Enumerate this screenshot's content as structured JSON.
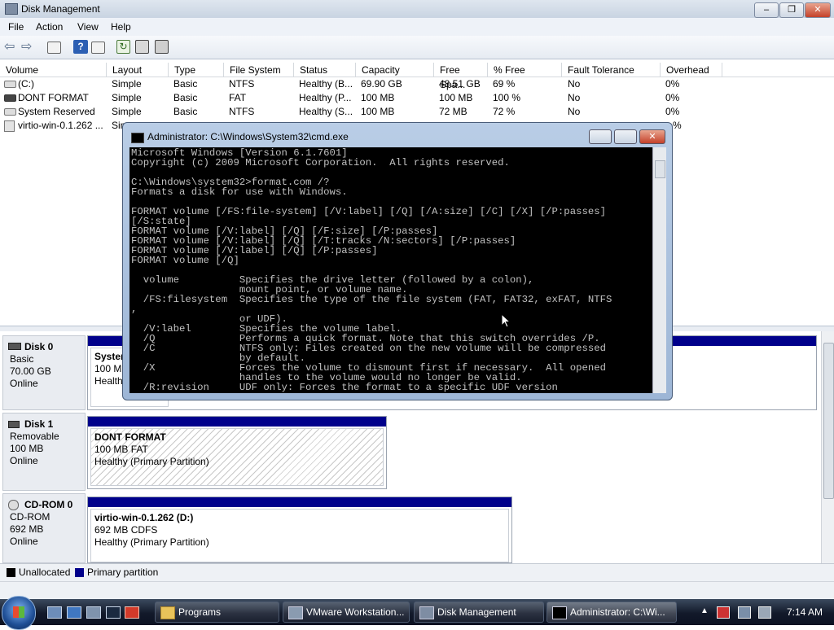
{
  "window": {
    "title": "Disk Management",
    "min": "–",
    "max": "❐",
    "close": "✕"
  },
  "menu": [
    "File",
    "Action",
    "View",
    "Help"
  ],
  "toolbar_icons": [
    "back-icon",
    "forward-icon",
    "properties-icon",
    "help-icon",
    "console-icon",
    "refresh-icon",
    "settings-icon",
    "wizard-icon"
  ],
  "volumes": {
    "columns": [
      "Volume",
      "Layout",
      "Type",
      "File System",
      "Status",
      "Capacity",
      "Free Spa...",
      "% Free",
      "Fault Tolerance",
      "Overhead"
    ],
    "rows": [
      [
        "(C:)",
        "Simple",
        "Basic",
        "NTFS",
        "Healthy (B...",
        "69.90 GB",
        "48.51 GB",
        "69 %",
        "No",
        "0%"
      ],
      [
        "DONT FORMAT",
        "Simple",
        "Basic",
        "FAT",
        "Healthy (P...",
        "100 MB",
        "100 MB",
        "100 %",
        "No",
        "0%"
      ],
      [
        "System Reserved",
        "Simple",
        "Basic",
        "NTFS",
        "Healthy (S...",
        "100 MB",
        "72 MB",
        "72 %",
        "No",
        "0%"
      ],
      [
        "virtio-win-0.1.262 ...",
        "Sim",
        "",
        "",
        "",
        "",
        "",
        "",
        "",
        "%"
      ]
    ]
  },
  "disks": [
    {
      "name": "Disk 0",
      "type": "Basic",
      "size": "70.00 GB",
      "status": "Online",
      "partition": {
        "name": "System",
        "line2": "100 MB",
        "line3": "Healthy"
      }
    },
    {
      "name": "Disk 1",
      "type": "Removable",
      "size": "100 MB",
      "status": "Online",
      "partition": {
        "name": "DONT FORMAT",
        "line2": "100 MB FAT",
        "line3": "Healthy (Primary Partition)"
      }
    },
    {
      "name": "CD-ROM 0",
      "type": "CD-ROM",
      "size": "692 MB",
      "status": "Online",
      "partition": {
        "name": "virtio-win-0.1.262  (D:)",
        "line2": "692 MB CDFS",
        "line3": "Healthy (Primary Partition)"
      }
    }
  ],
  "legend": {
    "unallocated": "Unallocated",
    "primary": "Primary partition",
    "unallocated_color": "#000000",
    "primary_color": "#00008b"
  },
  "cmd": {
    "title": "Administrator: C:\\Windows\\System32\\cmd.exe",
    "text": "Microsoft Windows [Version 6.1.7601]\nCopyright (c) 2009 Microsoft Corporation.  All rights reserved.\n\nC:\\Windows\\system32>format.com /?\nFormats a disk for use with Windows.\n\nFORMAT volume [/FS:file-system] [/V:label] [/Q] [/A:size] [/C] [/X] [/P:passes]\n[/S:state]\nFORMAT volume [/V:label] [/Q] [/F:size] [/P:passes]\nFORMAT volume [/V:label] [/Q] [/T:tracks /N:sectors] [/P:passes]\nFORMAT volume [/V:label] [/Q] [/P:passes]\nFORMAT volume [/Q]\n\n  volume          Specifies the drive letter (followed by a colon),\n                  mount point, or volume name.\n  /FS:filesystem  Specifies the type of the file system (FAT, FAT32, exFAT, NTFS\n,\n                  or UDF).\n  /V:label        Specifies the volume label.\n  /Q              Performs a quick format. Note that this switch overrides /P.\n  /C              NTFS only: Files created on the new volume will be compressed\n                  by default.\n  /X              Forces the volume to dismount first if necessary.  All opened\n                  handles to the volume would no longer be valid.\n  /R:revision     UDF only: Forces the format to a specific UDF version"
  },
  "taskbar": {
    "buttons": [
      "Programs",
      "VMware Workstation...",
      "Disk Management",
      "Administrator: C:\\Wi..."
    ],
    "clock": "7:14 AM"
  }
}
